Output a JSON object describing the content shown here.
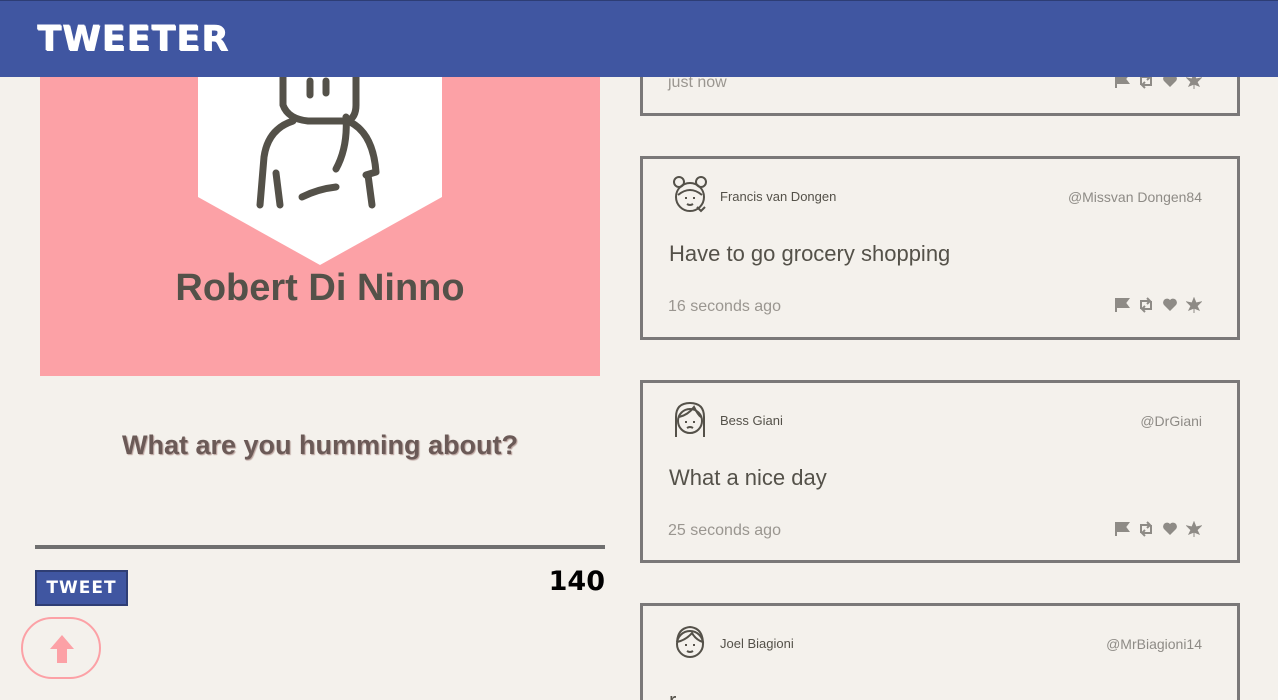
{
  "header": {
    "brand": "TWEETER"
  },
  "profile": {
    "name": "Robert Di Ninno"
  },
  "compose": {
    "prompt": "What are you humming about?",
    "tweet_button": "TWEET",
    "char_counter": "140"
  },
  "colors": {
    "header_bg": "#4056a1",
    "profile_bg": "#fca1a6",
    "page_bg": "#f4f1ec",
    "text": "#545149"
  },
  "icons": {
    "action_icons": [
      "flag-icon",
      "retweet-icon",
      "heart-icon",
      "leaf-icon"
    ],
    "scroll_top": "arrow-up-icon"
  },
  "tweets": [
    {
      "name": "",
      "handle": "",
      "text": "",
      "time": "just now"
    },
    {
      "name": "Francis van Dongen",
      "handle": "@Missvan Dongen84",
      "text": "Have to go grocery shopping",
      "time": "16 seconds ago"
    },
    {
      "name": "Bess Giani",
      "handle": "@DrGiani",
      "text": "What a nice day",
      "time": "25 seconds ago"
    },
    {
      "name": "Joel Biagioni",
      "handle": "@MrBiagioni14",
      "text": "r",
      "time": ""
    }
  ]
}
